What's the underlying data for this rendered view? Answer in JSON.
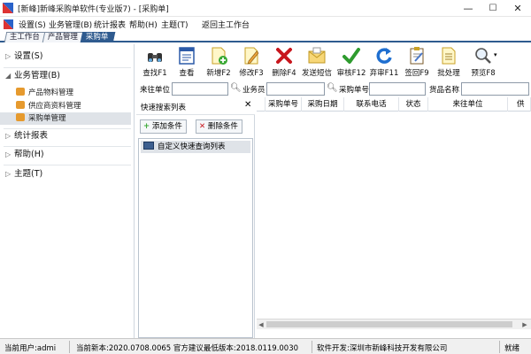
{
  "window": {
    "title": "[新峰]新峰采购单软件(专业版7) - [采购单]",
    "controls": {
      "minimize": "—",
      "maximize": "☐",
      "close": "✕"
    }
  },
  "menubar": {
    "items": [
      "设置(S)",
      "业务管理(B)",
      "统计报表",
      "帮助(H)",
      "主题(T)",
      "返回主工作台"
    ]
  },
  "tabs": [
    {
      "label": "主工作台",
      "active": false
    },
    {
      "label": "产品管理",
      "active": false
    },
    {
      "label": "采购单",
      "active": true
    }
  ],
  "sidebar": {
    "sections": [
      {
        "label": "设置(S)",
        "expanded": false
      },
      {
        "label": "业务管理(B)",
        "expanded": true
      },
      {
        "label": "统计报表",
        "expanded": false
      },
      {
        "label": "帮助(H)",
        "expanded": false
      },
      {
        "label": "主题(T)",
        "expanded": false
      }
    ],
    "business_items": [
      {
        "label": "产品物料管理",
        "selected": false
      },
      {
        "label": "供应商资料管理",
        "selected": false
      },
      {
        "label": "采购单管理",
        "selected": true
      }
    ]
  },
  "toolbar": {
    "buttons": [
      {
        "label": "查找F1",
        "icon": "binoculars-icon"
      },
      {
        "label": "查看",
        "icon": "view-form-icon"
      },
      {
        "label": "新增F2",
        "icon": "new-document-icon"
      },
      {
        "label": "修改F3",
        "icon": "edit-pencil-icon"
      },
      {
        "label": "删除F4",
        "icon": "delete-x-icon"
      },
      {
        "label": "发送短信",
        "icon": "envelope-icon"
      },
      {
        "label": "审核F12",
        "icon": "checkmark-icon"
      },
      {
        "label": "弃审F11",
        "icon": "undo-arrow-icon"
      },
      {
        "label": "签回F9",
        "icon": "clipboard-icon"
      },
      {
        "label": "批处理",
        "icon": "batch-icon"
      },
      {
        "label": "预览F8",
        "icon": "magnifier-icon"
      }
    ]
  },
  "filters": {
    "supplier_label": "来往单位",
    "salesman_label": "业务员",
    "order_no_label": "采购单号",
    "goods_label": "货品名称",
    "supplier_value": "",
    "salesman_value": "",
    "order_no_value": "",
    "goods_value": ""
  },
  "query_panel": {
    "title": "快速搜索列表",
    "close_glyph": "✕",
    "add_button": "添加条件",
    "delete_button": "删除条件",
    "items": [
      "自定义快速查询列表"
    ]
  },
  "grid": {
    "columns": [
      "采购单号",
      "采购日期",
      "联系电话",
      "状态",
      "来往单位",
      "供"
    ]
  },
  "statusbar": {
    "user": "当前用户:admi",
    "version": "当前新本:2020.0708.0065 官方建议最低版本:2018.0119.0030",
    "developer": "软件开发:深圳市新峰科技开发有限公司",
    "state": "就绪"
  },
  "colors": {
    "tab_active": "#2f5b8f",
    "selected_row": "#dfe3e8",
    "status_bar": "#f0f0f0"
  }
}
